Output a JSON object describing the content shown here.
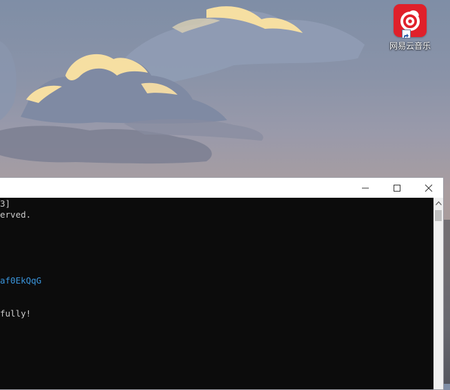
{
  "desktop": {
    "icons": [
      {
        "label": "网易云音乐",
        "icon": "netease-cloud-music-icon",
        "color": "#e0202a"
      }
    ]
  },
  "console": {
    "caption": {
      "minimize": "minimize-icon",
      "maximize": "maximize-icon",
      "close": "close-icon"
    },
    "lines": [
      "3]",
      "erved.",
      "af0EkQqG",
      "fully!"
    ]
  },
  "colors": {
    "console_bg": "#0c0c0c",
    "console_text": "#cccccc",
    "link_text": "#3a96dd",
    "icon_red": "#e0202a",
    "cloud_highlight": "#f6dfa2"
  }
}
